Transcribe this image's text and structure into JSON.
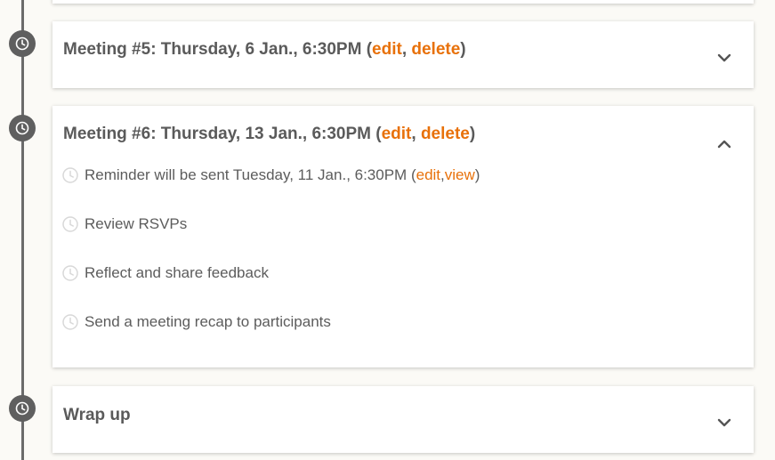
{
  "colors": {
    "accent": "#e8710a",
    "timeline": "#5f5f5f",
    "background": "#fbfaf6"
  },
  "cards": [
    {
      "title_prefix": "Meeting #5: Thursday, 6 Jan., 6:30PM (",
      "edit": "edit",
      "comma": ", ",
      "delete": "delete",
      "close": ")",
      "expanded": false,
      "chevron": "chevron-down-icon"
    },
    {
      "title_prefix": "Meeting #6: Thursday, 13 Jan., 6:30PM (",
      "edit": "edit",
      "comma": ", ",
      "delete": "delete",
      "close": ")",
      "expanded": true,
      "chevron": "chevron-up-icon",
      "tasks": [
        {
          "text": "Reminder will be sent Tuesday, 11 Jan., 6:30PM (",
          "edit": "edit",
          "comma": ", ",
          "view": "view",
          "close": ")"
        },
        {
          "text": "Review RSVPs"
        },
        {
          "text": "Reflect and share feedback"
        },
        {
          "text": "Send a meeting recap to participants"
        }
      ]
    },
    {
      "title": "Wrap up",
      "expanded": false,
      "chevron": "chevron-down-icon"
    }
  ]
}
